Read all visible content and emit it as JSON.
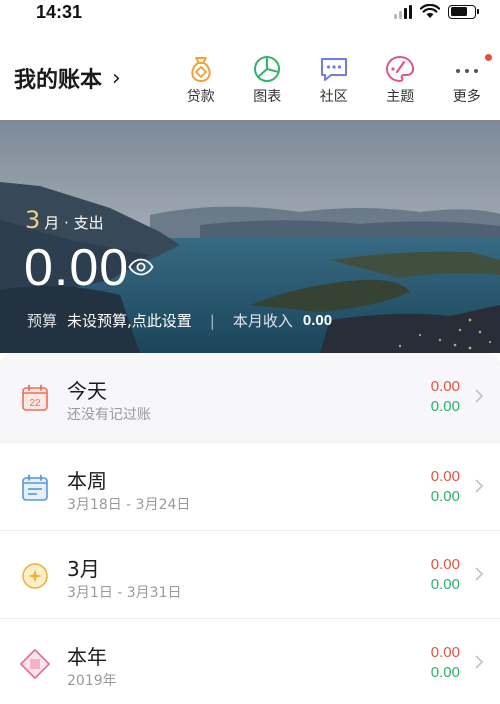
{
  "status_bar": {
    "time": "14:31"
  },
  "header": {
    "book_title": "我的账本",
    "nav": [
      {
        "label": "贷款",
        "icon": "loan-bag-icon"
      },
      {
        "label": "图表",
        "icon": "pie-chart-icon"
      },
      {
        "label": "社区",
        "icon": "chat-bubble-icon"
      },
      {
        "label": "主题",
        "icon": "palette-icon"
      },
      {
        "label": "更多",
        "icon": "more-dots-icon"
      }
    ]
  },
  "summary": {
    "month": "3",
    "month_suffix": "月 · 支出",
    "amount": "0.00",
    "budget_label": "预算",
    "budget_value": "未设预算,点此设置",
    "income_label": "本月收入",
    "income_value": "0.00"
  },
  "periods": [
    {
      "title": "今天",
      "subtitle": "还没有记过账",
      "expense": "0.00",
      "income": "0.00",
      "icon": "calendar-day-icon",
      "badge": "22"
    },
    {
      "title": "本周",
      "subtitle": "3月18日 - 3月24日",
      "expense": "0.00",
      "income": "0.00",
      "icon": "calendar-week-icon"
    },
    {
      "title": "3月",
      "subtitle": "3月1日 - 3月31日",
      "expense": "0.00",
      "income": "0.00",
      "icon": "moon-icon"
    },
    {
      "title": "本年",
      "subtitle": "2019年",
      "expense": "0.00",
      "income": "0.00",
      "icon": "diamond-icon"
    }
  ],
  "colors": {
    "expense": "#e3553f",
    "income": "#2fae6c",
    "accent_gold": "#f0d080"
  }
}
